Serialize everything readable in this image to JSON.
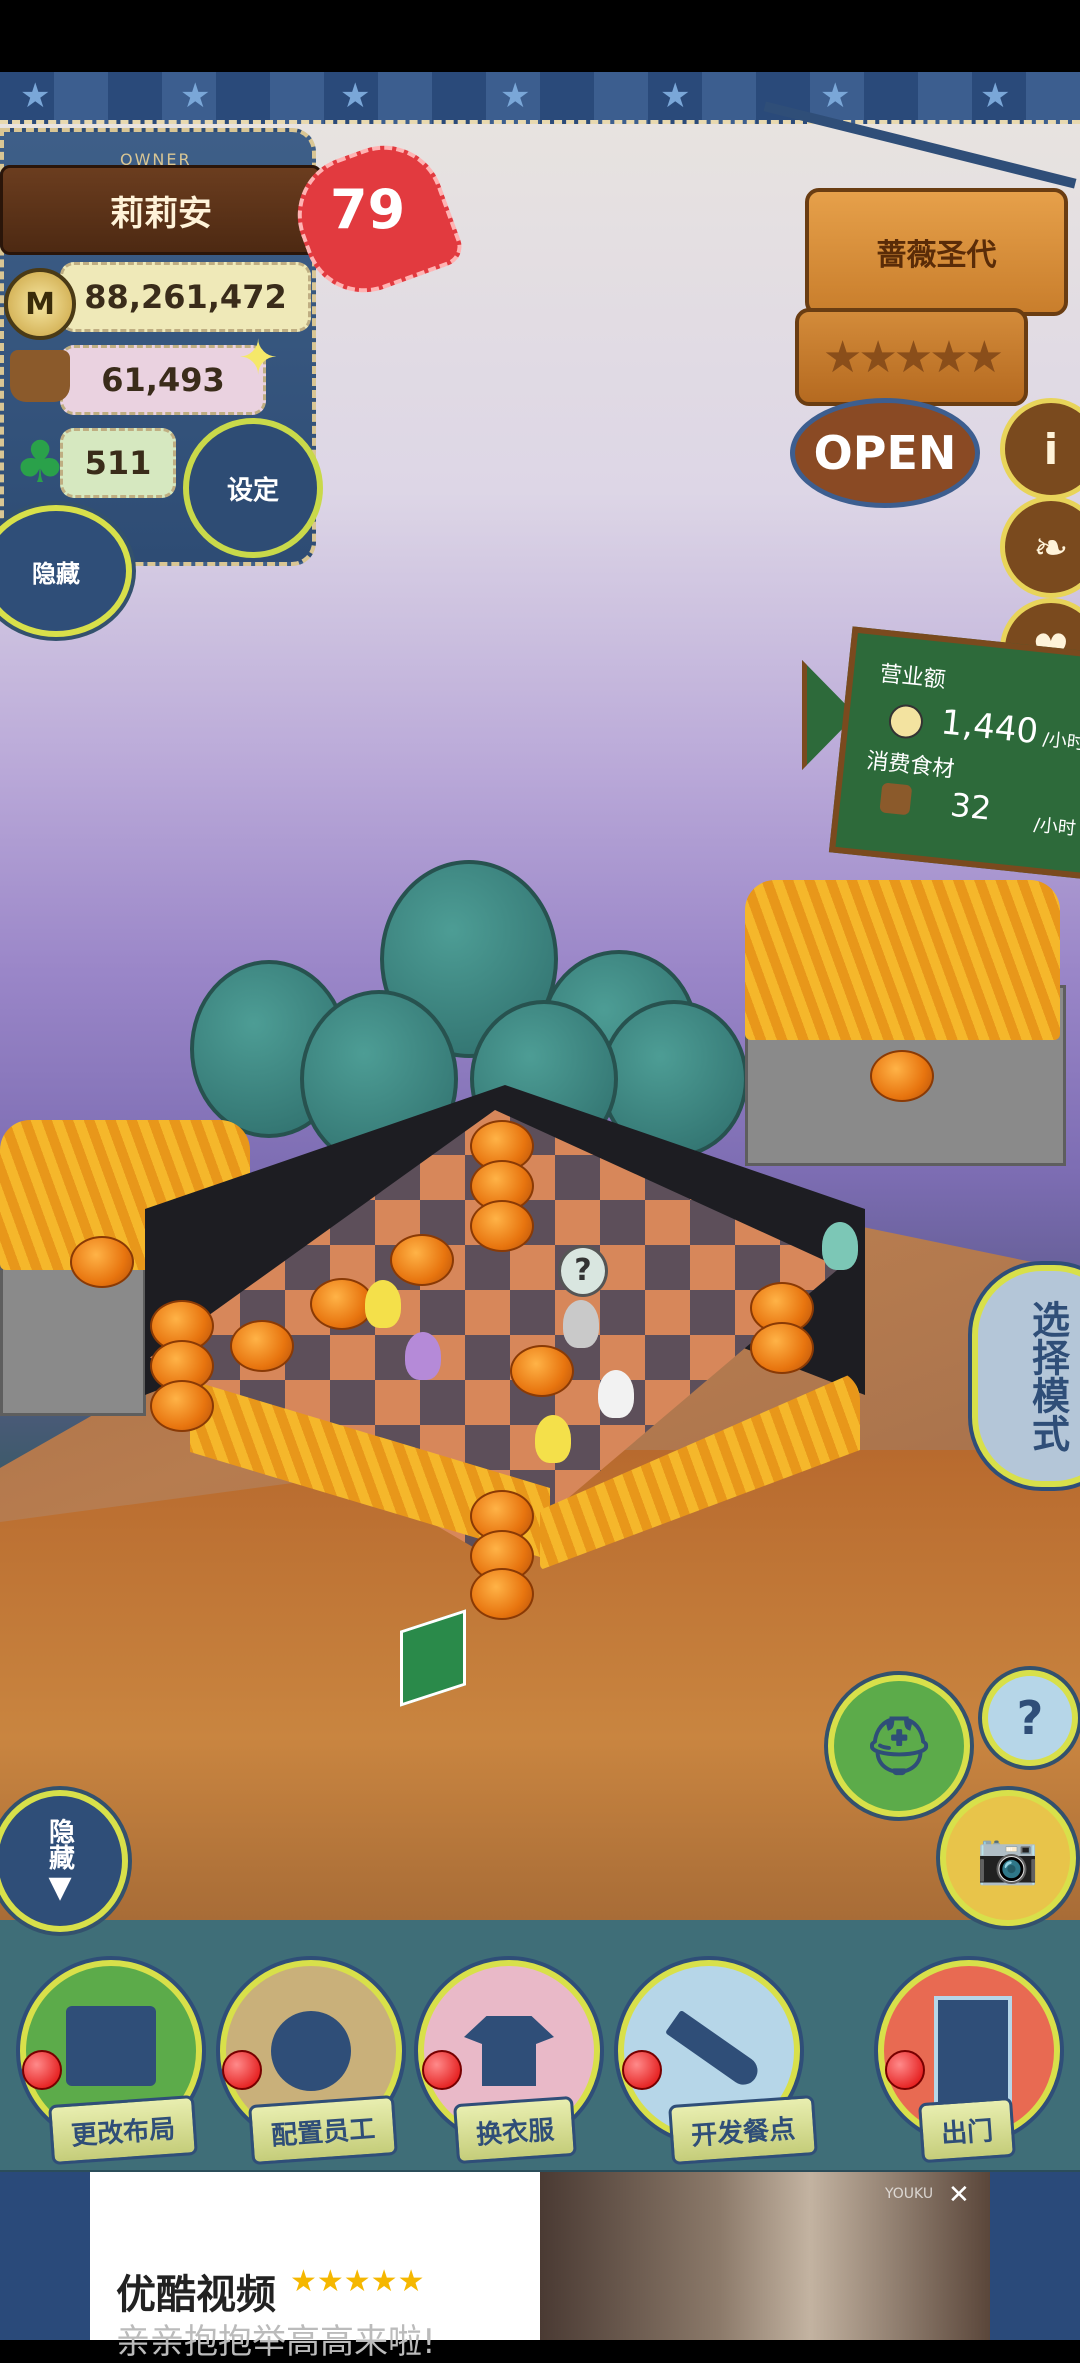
{
  "owner": {
    "tag": "OWNER",
    "name": "莉莉安",
    "heart_level": "79",
    "coins": "88,261,472",
    "ingredients": "61,493",
    "clovers": "511",
    "coin_symbol": "M"
  },
  "buttons": {
    "settings": "设定",
    "hide_top": "隐藏",
    "hide_bottom": "隐藏",
    "mode": "选择模式",
    "help": "?"
  },
  "sign": {
    "restaurant_name": "蔷薇圣代",
    "stars": "★★★★★",
    "status": "OPEN",
    "info_icon": "i"
  },
  "revenue": {
    "sales_label": "营业额",
    "sales_value": "1,440",
    "sales_unit": "/小时",
    "consume_label": "消费食材",
    "consume_value": "32",
    "consume_unit": "/小时"
  },
  "actions": [
    {
      "label": "更改布局",
      "color": "#5cab4a"
    },
    {
      "label": "配置员工",
      "color": "#c9b07a"
    },
    {
      "label": "换衣服",
      "color": "#e9b9c8"
    },
    {
      "label": "开发餐点",
      "color": "#b6d6e8"
    },
    {
      "label": "出门",
      "color": "#e86a52"
    }
  ],
  "ad": {
    "title": "优酷视频",
    "rating": "★★★★★",
    "subtitle": "亲亲抱抱举高高来啦!",
    "close": "✕",
    "watermark": "YOUKU"
  }
}
